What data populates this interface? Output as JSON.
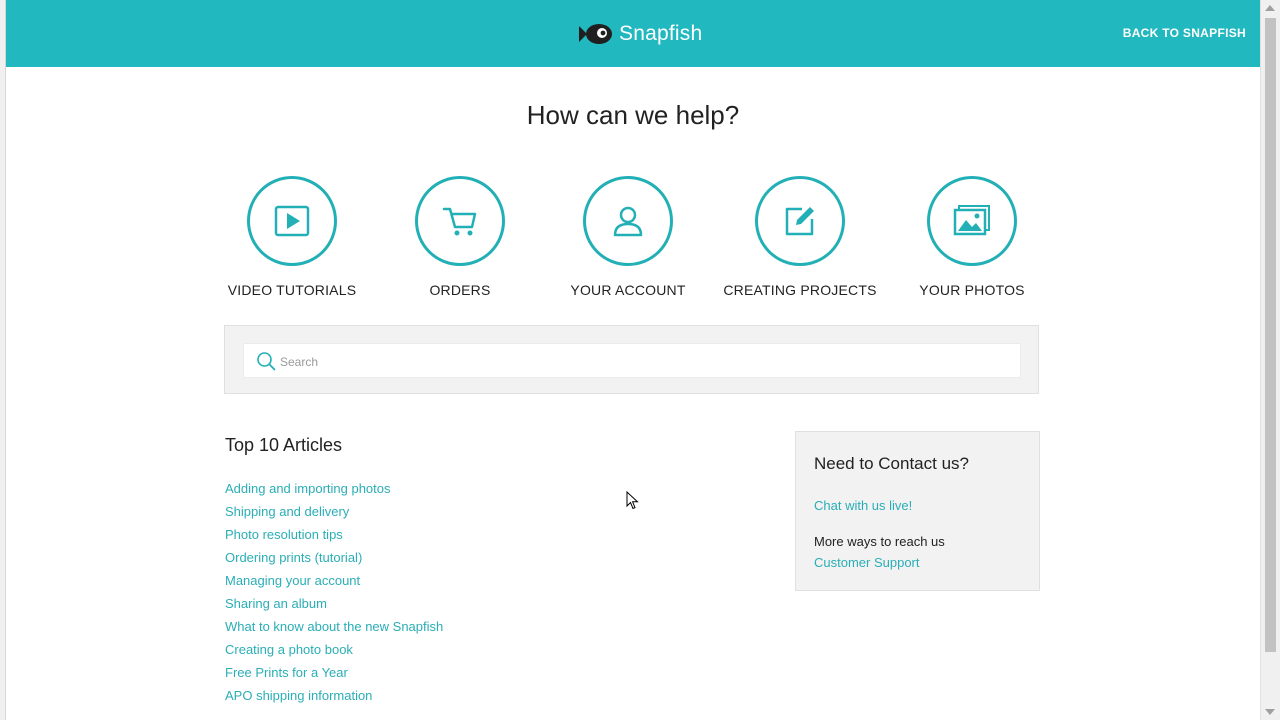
{
  "header": {
    "logo_text": "Snapfish",
    "back_link": "BACK TO SNAPFISH",
    "bg_color": "#22b8c0"
  },
  "page_title": "How can we help?",
  "categories": [
    {
      "label": "VIDEO TUTORIALS",
      "icon": "play-icon"
    },
    {
      "label": "ORDERS",
      "icon": "cart-icon"
    },
    {
      "label": "YOUR ACCOUNT",
      "icon": "user-icon"
    },
    {
      "label": "CREATING PROJECTS",
      "icon": "edit-icon"
    },
    {
      "label": "YOUR PHOTOS",
      "icon": "photo-icon"
    }
  ],
  "search": {
    "placeholder": "Search",
    "value": ""
  },
  "articles": {
    "title": "Top 10 Articles",
    "items": [
      "Adding and importing photos",
      "Shipping and delivery",
      "Photo resolution tips",
      "Ordering prints (tutorial)",
      "Managing your account",
      "Sharing an album",
      "What to know about the new Snapfish",
      "Creating a photo book",
      "Free Prints for a Year",
      "APO shipping information"
    ]
  },
  "contact": {
    "title": "Need to Contact us?",
    "chat_link": "Chat with us live!",
    "more_text": "More ways to reach us",
    "support_link": "Customer Support"
  },
  "colors": {
    "accent": "#22b8c0",
    "link": "#2aaeb6"
  }
}
